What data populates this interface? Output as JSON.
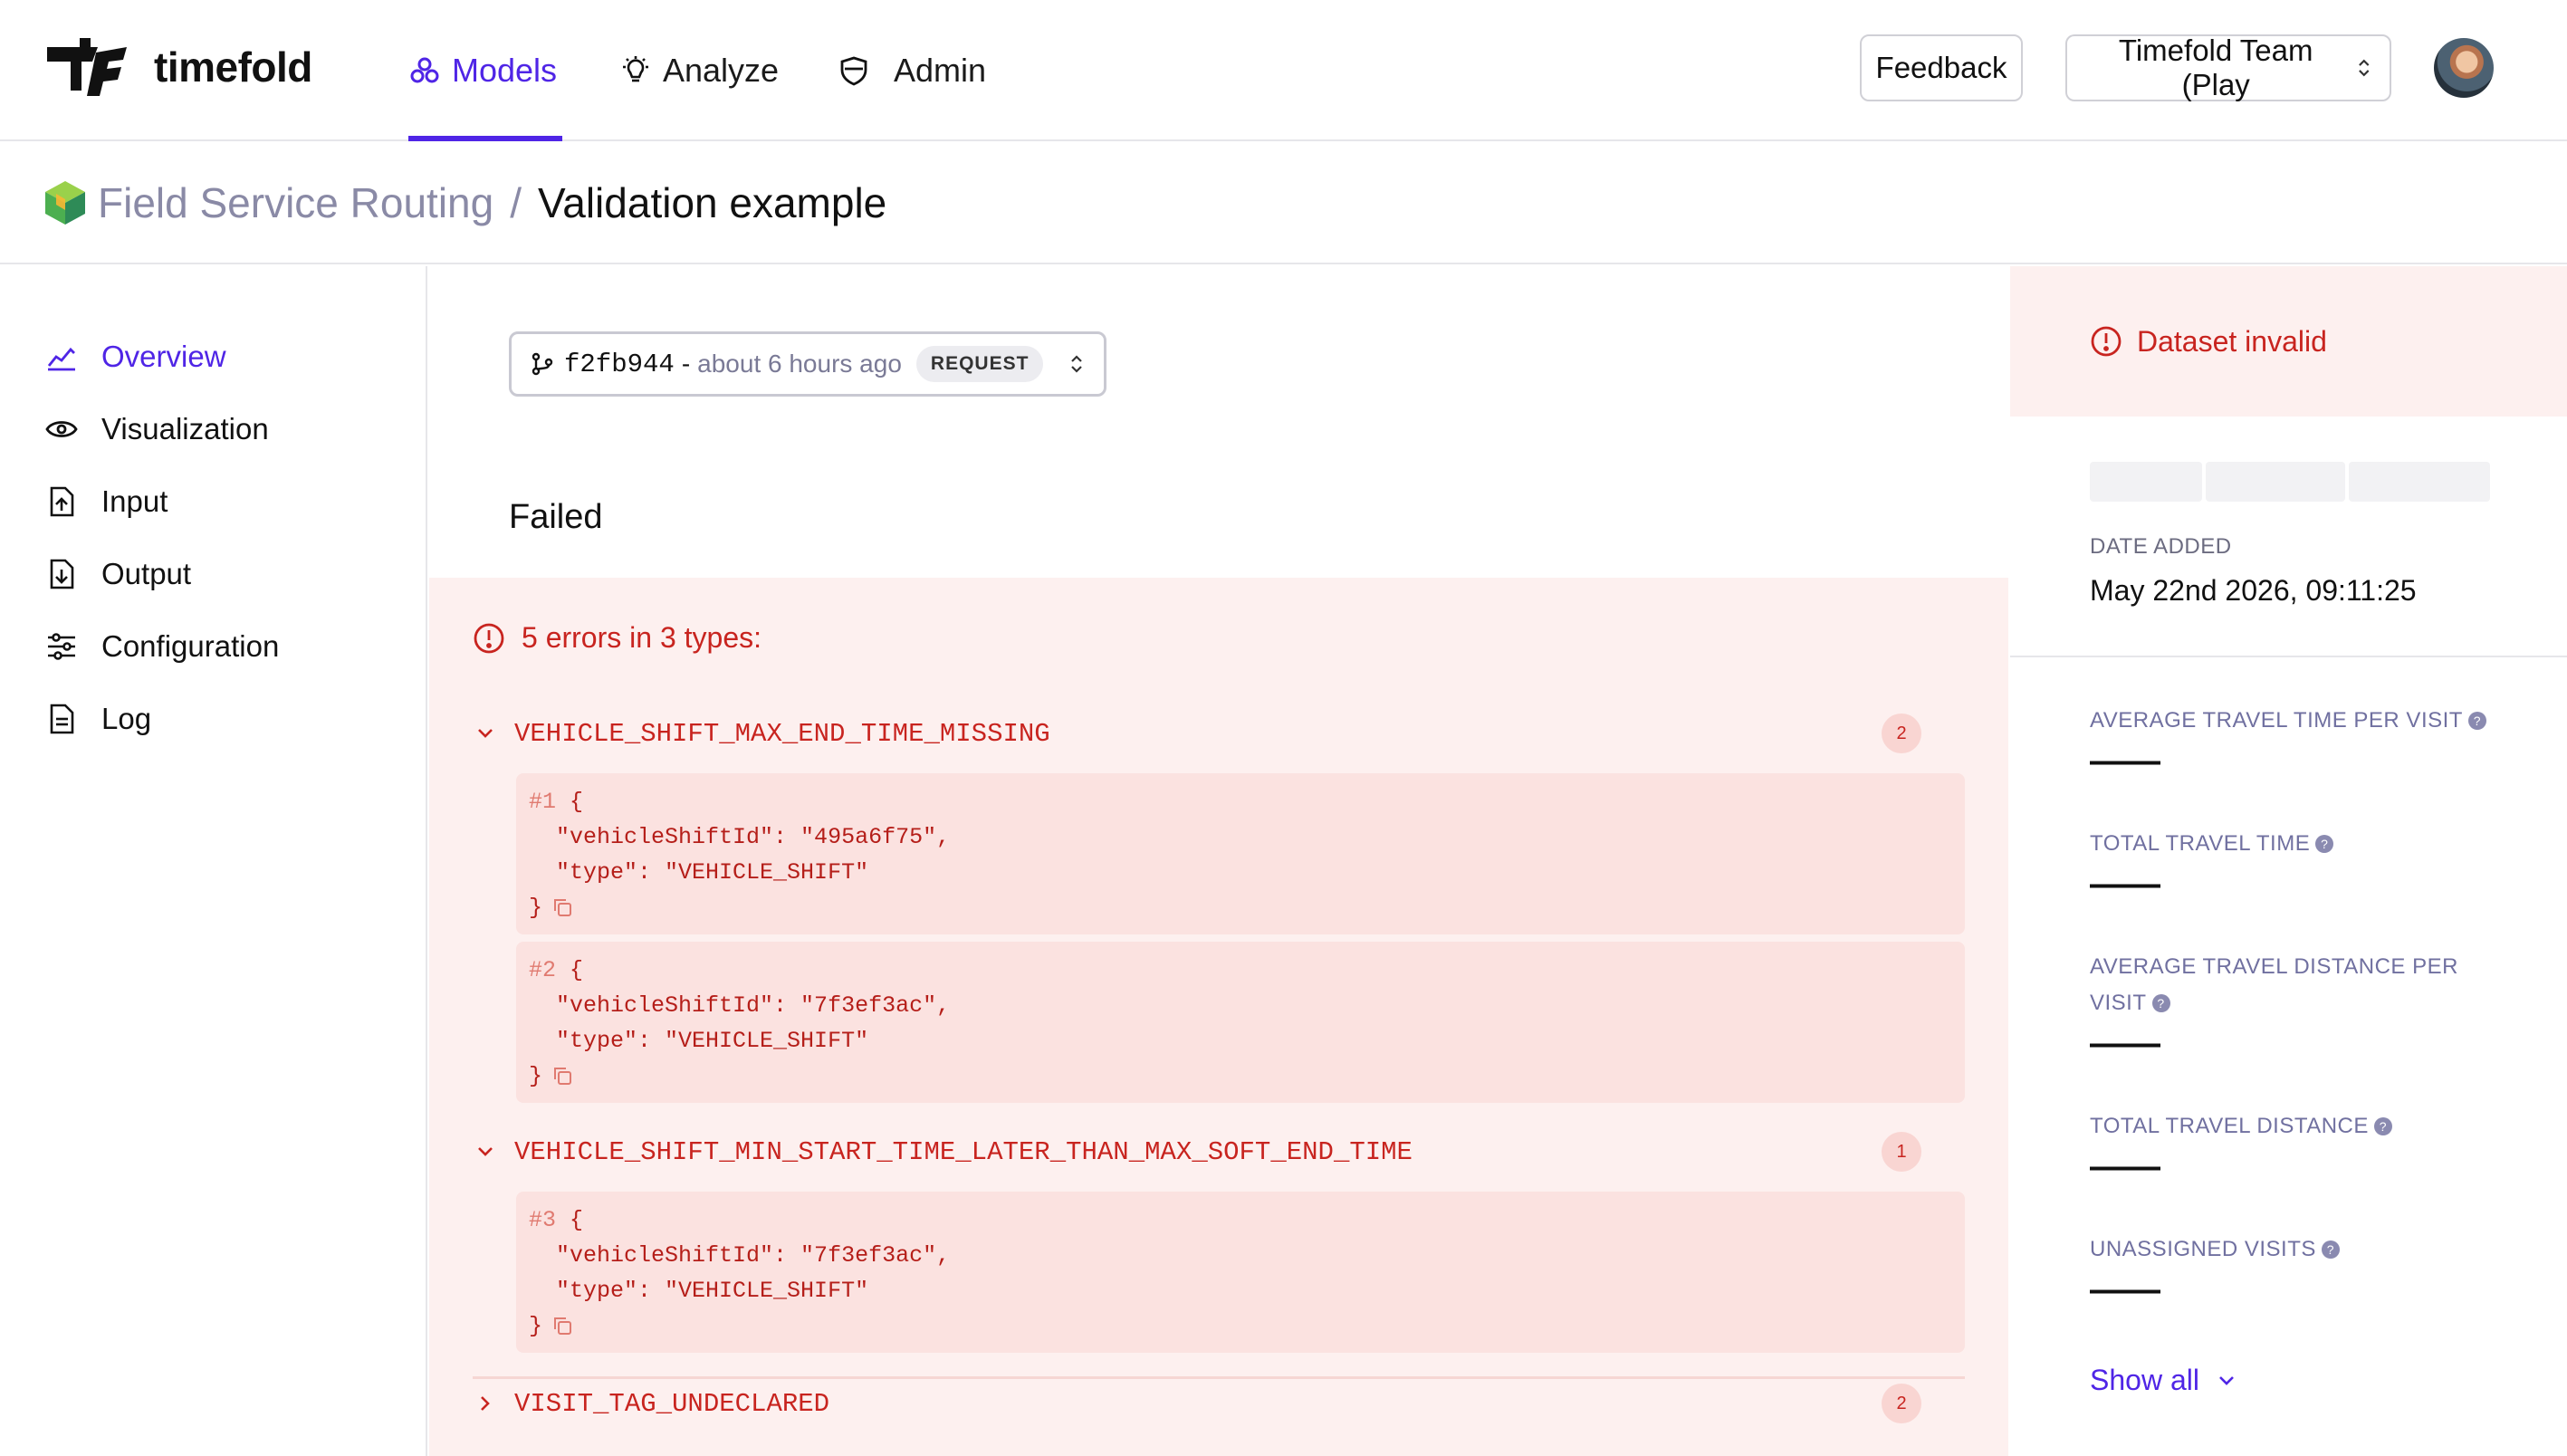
{
  "brand": {
    "name": "timefold"
  },
  "nav": {
    "tabs": [
      {
        "label": "Models",
        "icon": "models-icon",
        "active": true
      },
      {
        "label": "Analyze",
        "icon": "bulb-icon",
        "active": false
      },
      {
        "label": "Admin",
        "icon": "shield-icon",
        "active": false
      }
    ],
    "feedback_label": "Feedback",
    "team_label": "Timefold Team (Play",
    "accent": "#4f25e6"
  },
  "breadcrumb": {
    "parent": "Field Service Routing",
    "separator": "/",
    "current": "Validation example"
  },
  "sidebar": {
    "items": [
      {
        "label": "Overview",
        "icon": "chart-icon",
        "active": true
      },
      {
        "label": "Visualization",
        "icon": "eye-icon",
        "active": false
      },
      {
        "label": "Input",
        "icon": "file-upload-icon",
        "active": false
      },
      {
        "label": "Output",
        "icon": "file-download-icon",
        "active": false
      },
      {
        "label": "Configuration",
        "icon": "sliders-icon",
        "active": false
      },
      {
        "label": "Log",
        "icon": "document-icon",
        "active": false
      }
    ]
  },
  "run": {
    "hash": "f2fb944",
    "dash": "-",
    "time": "about 6 hours ago",
    "badge": "REQUEST"
  },
  "status": "Failed",
  "errors": {
    "summary": "5 errors in 3 types:",
    "color": "#c8241f",
    "types": [
      {
        "name": "VEHICLE_SHIFT_MAX_END_TIME_MISSING",
        "count": "2",
        "expanded": true,
        "items": [
          {
            "num": "#1",
            "vehicleShiftId": "\"vehicleShiftId\": \"495a6f75\",",
            "type": "\"type\": \"VEHICLE_SHIFT\""
          },
          {
            "num": "#2",
            "vehicleShiftId": "\"vehicleShiftId\": \"7f3ef3ac\",",
            "type": "\"type\": \"VEHICLE_SHIFT\""
          }
        ]
      },
      {
        "name": "VEHICLE_SHIFT_MIN_START_TIME_LATER_THAN_MAX_SOFT_END_TIME",
        "count": "1",
        "expanded": true,
        "items": [
          {
            "num": "#3",
            "vehicleShiftId": "\"vehicleShiftId\": \"7f3ef3ac\",",
            "type": "\"type\": \"VEHICLE_SHIFT\""
          }
        ]
      },
      {
        "name": "VISIT_TAG_UNDECLARED",
        "count": "2",
        "expanded": false,
        "items": []
      }
    ]
  },
  "right": {
    "banner": "Dataset invalid",
    "date_label": "DATE ADDED",
    "date_value": "May 22nd 2026, 09:11:25",
    "kpis": [
      {
        "label": "AVERAGE TRAVEL TIME PER VISIT",
        "value": "——"
      },
      {
        "label": "TOTAL TRAVEL TIME",
        "value": "——"
      },
      {
        "label": "AVERAGE TRAVEL DISTANCE PER VISIT",
        "value": "——"
      },
      {
        "label": "TOTAL TRAVEL DISTANCE",
        "value": "——"
      },
      {
        "label": "UNASSIGNED VISITS",
        "value": "——"
      }
    ],
    "show_all": "Show all"
  }
}
